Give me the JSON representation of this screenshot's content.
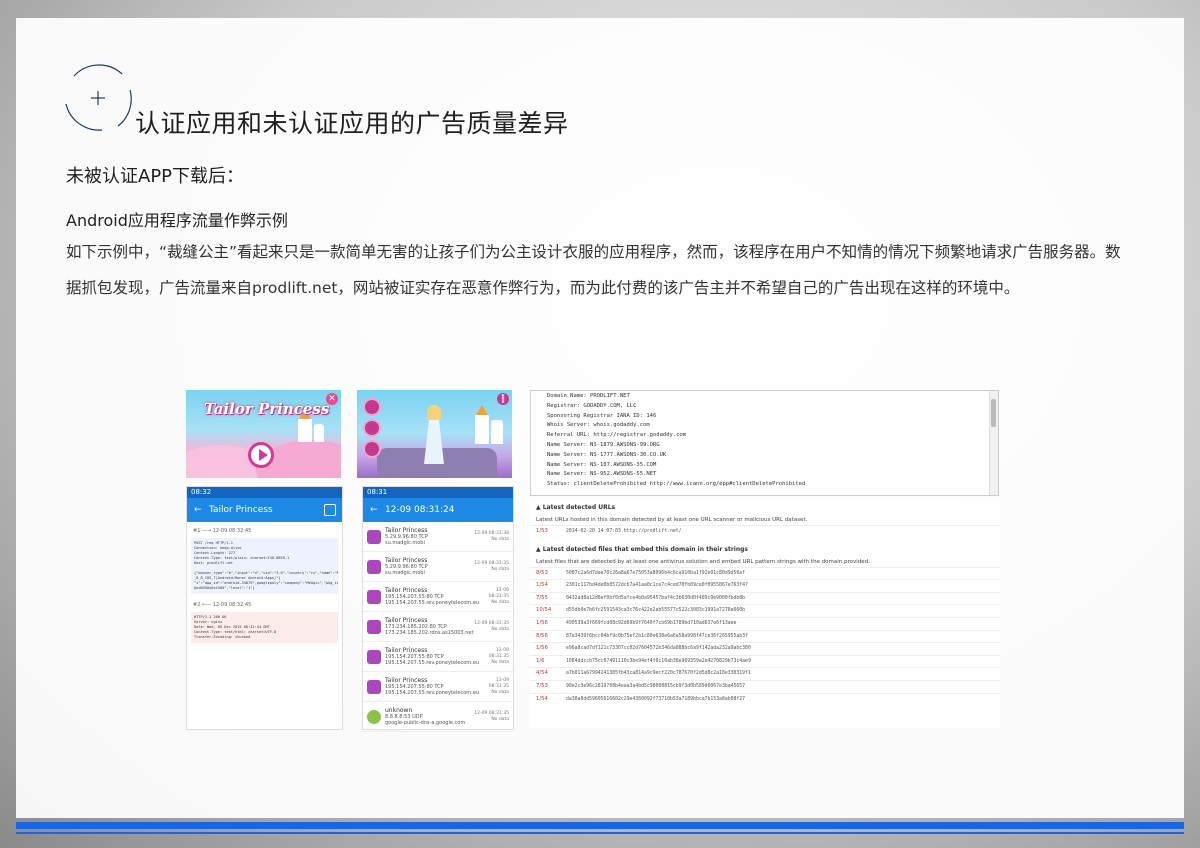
{
  "title": "认证应用和未认证应用的广告质量差异",
  "subtitle": "未被认证APP下载后：",
  "section_heading": "Android应用程序流量作弊示例",
  "body": "如下示例中，“裁缝公主”看起来只是一款简单无害的让孩子们为公主设计衣服的应用程序，然而，该程序在用户不知情的情况下频繁地请求广告服务器。数据抓包发现，广告流量来自prodlift.net，网站被证实存在恶意作弊行为，而为此付费的该广告主并不希望自己的广告出现在这样的环境中。",
  "colors": {
    "accent": "#1a66e0"
  },
  "figure": {
    "game_title": "Tailor Princess",
    "phone1": {
      "status": "08:32",
      "title": "Tailor Princess",
      "req_head": "#1 —→ 12-09 08:32:45",
      "req_log": "POST /req HTTP/1.1\nConnection: keep-alive\nContent-Length: 277\nContent-Type: text/plain; charset=ISO-8859-1\nHost: prodlift.net\n\n{\"banner_type\":\"b\",\"input\":\"d\",\"uid\":\"3.0\",\"country\":\"ru\",\"name\":\"MeGgic\n_0_8_CHS_7(Android/Honor Android:Apps)\"}\n\"i\":\"app_id\":\"android-54879\",googlepaly\":\"company\":\"MeGgic\",\"pkg_id\":\"Rt\nAnd0350x0x1505\",\"level\":\"1\"}",
      "resp_head": "#2 ←— 12-09 08:32:45",
      "resp_log": "HTTP/1.1 200 OK\nServer: nginx\nDate: Wed, 09 Dec 2015 08:32:44 GMT\nContent-Type: text/html; charset=UTF-8\nTransfer-Encoding: chunked"
    },
    "phone2": {
      "status": "08:31",
      "title": "12-09 08:31:24",
      "rows": [
        {
          "name": "Tailor Princess",
          "ip": "5.29.9.96:80 TCP",
          "host": "su.madgic.mobi",
          "time": "12-09 08:31:38",
          "data": "No data"
        },
        {
          "name": "Tailor Princess",
          "ip": "5.29.9.96:80 TCP",
          "host": "su.madgic.mobi",
          "time": "12-09 08:31:35",
          "data": "No data"
        },
        {
          "name": "Tailor Princess",
          "ip": "195.154.207.55:80 TCP",
          "host": "195.154.207.55.rev.poneytelecom.eu",
          "time": "12-09 08:31:35",
          "data": "No data"
        },
        {
          "name": "Tailor Princess",
          "ip": "173.234.185.202:80 TCP",
          "host": "173.234.185.202.rdns.as15003.net",
          "time": "12-09 08:31:35",
          "data": "No data"
        },
        {
          "name": "Tailor Princess",
          "ip": "195.154.207.55:80 TCP",
          "host": "195.154.207.55.rev.poneytelecom.eu",
          "time": "12-09 08:31:35",
          "data": "No data"
        },
        {
          "name": "Tailor Princess",
          "ip": "195.154.207.55:80 TCP",
          "host": "195.154.207.55.rev.poneytelecom.eu",
          "time": "12-09 08:31:35",
          "data": "No data"
        },
        {
          "name": "unknown",
          "ip": "8.8.8.8:53 UDP",
          "host": "google-public-dns-a.google.com",
          "time": "12-09 08:31:35",
          "data": "No data"
        }
      ]
    },
    "whois": "Domain Name: PRODLIFT.NET\nRegistrar: GODADDY.COM, LLC\nSponsoring Registrar IANA ID: 146\nWhois Server: whois.godaddy.com\nReferral URL: http://registrar.godaddy.com\nName Server: NS-1879.AWSDNS-99.ORG\nName Server: NS-1777.AWSDNS-30.CO.UK\nName Server: NS-187.AWSDNS-35.COM\nName Server: NS-952.AWSDNS-55.NET\nStatus: clientDeleteProhibited http://www.icann.org/epp#clientDeleteProhibited",
    "vt": {
      "urls_heading": "Latest detected URLs",
      "urls_desc": "Latest URLs hosted in this domain detected by at least one URL scanner or malicious URL dataset.",
      "url_rows": [
        {
          "score": "1/53",
          "value": "2014-02-20 14:07:03   http://prodlift.net/"
        }
      ],
      "files_heading": "Latest detected files that embed this domain in their strings",
      "files_desc": "Latest files that are detected by at least one antivirus solution and embed URL pattern strings with the domain provided.",
      "file_rows": [
        {
          "score": "8/53",
          "value": "5087c2a6d7dae70c26a8a67e75053a8096b4c6ca910ba1f92e01c80d9d50af"
        },
        {
          "score": "1/54",
          "value": "2301c117bd4de0b0572dcb7a41aa0c1ce7c4ced70fb09ce0f0955067e763f47"
        },
        {
          "score": "7/55",
          "value": "0432ad8a12d8ef0bf0d5afce4b0a95457baf4c3b630d0f409c9e9000fbdb8b"
        },
        {
          "score": "10/54",
          "value": "d55db0e7b6fc2591543ca3c76c422e2ab55577c522c3083c1991a7278e660b"
        },
        {
          "score": "1/56",
          "value": "490539a3f669fcd08c92d69b9f7640f7cb69b1789bd710ad637e6f13aee"
        },
        {
          "score": "8/56",
          "value": "87e3439f6bcc04bf9c0b75ef2b1c80e638e6a6a58a998f47ce36f265955ab3f"
        },
        {
          "score": "1/56",
          "value": "e96a8cad7df121c73307cc02d7604572b346da088bc6a9f142ada232a9abc380"
        },
        {
          "score": "1/6",
          "value": "1084ddccb75cc07491110c3be94ef4f6c10ab36e969359a2e4270829b73c4ae9"
        },
        {
          "score": "4/54",
          "value": "a7b011a67994241305fb43ca814a9c9ecf220c787670f2d5d8c2a18e330319f1"
        },
        {
          "score": "7/53",
          "value": "90e2c3e96c2819708b4eaa3a4bd5c98008815cb9f3d0b589d6067e3ba45657"
        },
        {
          "score": "1/54",
          "value": "da30a0dd59605616602c29e4360092f73710b53a7189bbca7b153a8ab08f27"
        }
      ]
    }
  }
}
